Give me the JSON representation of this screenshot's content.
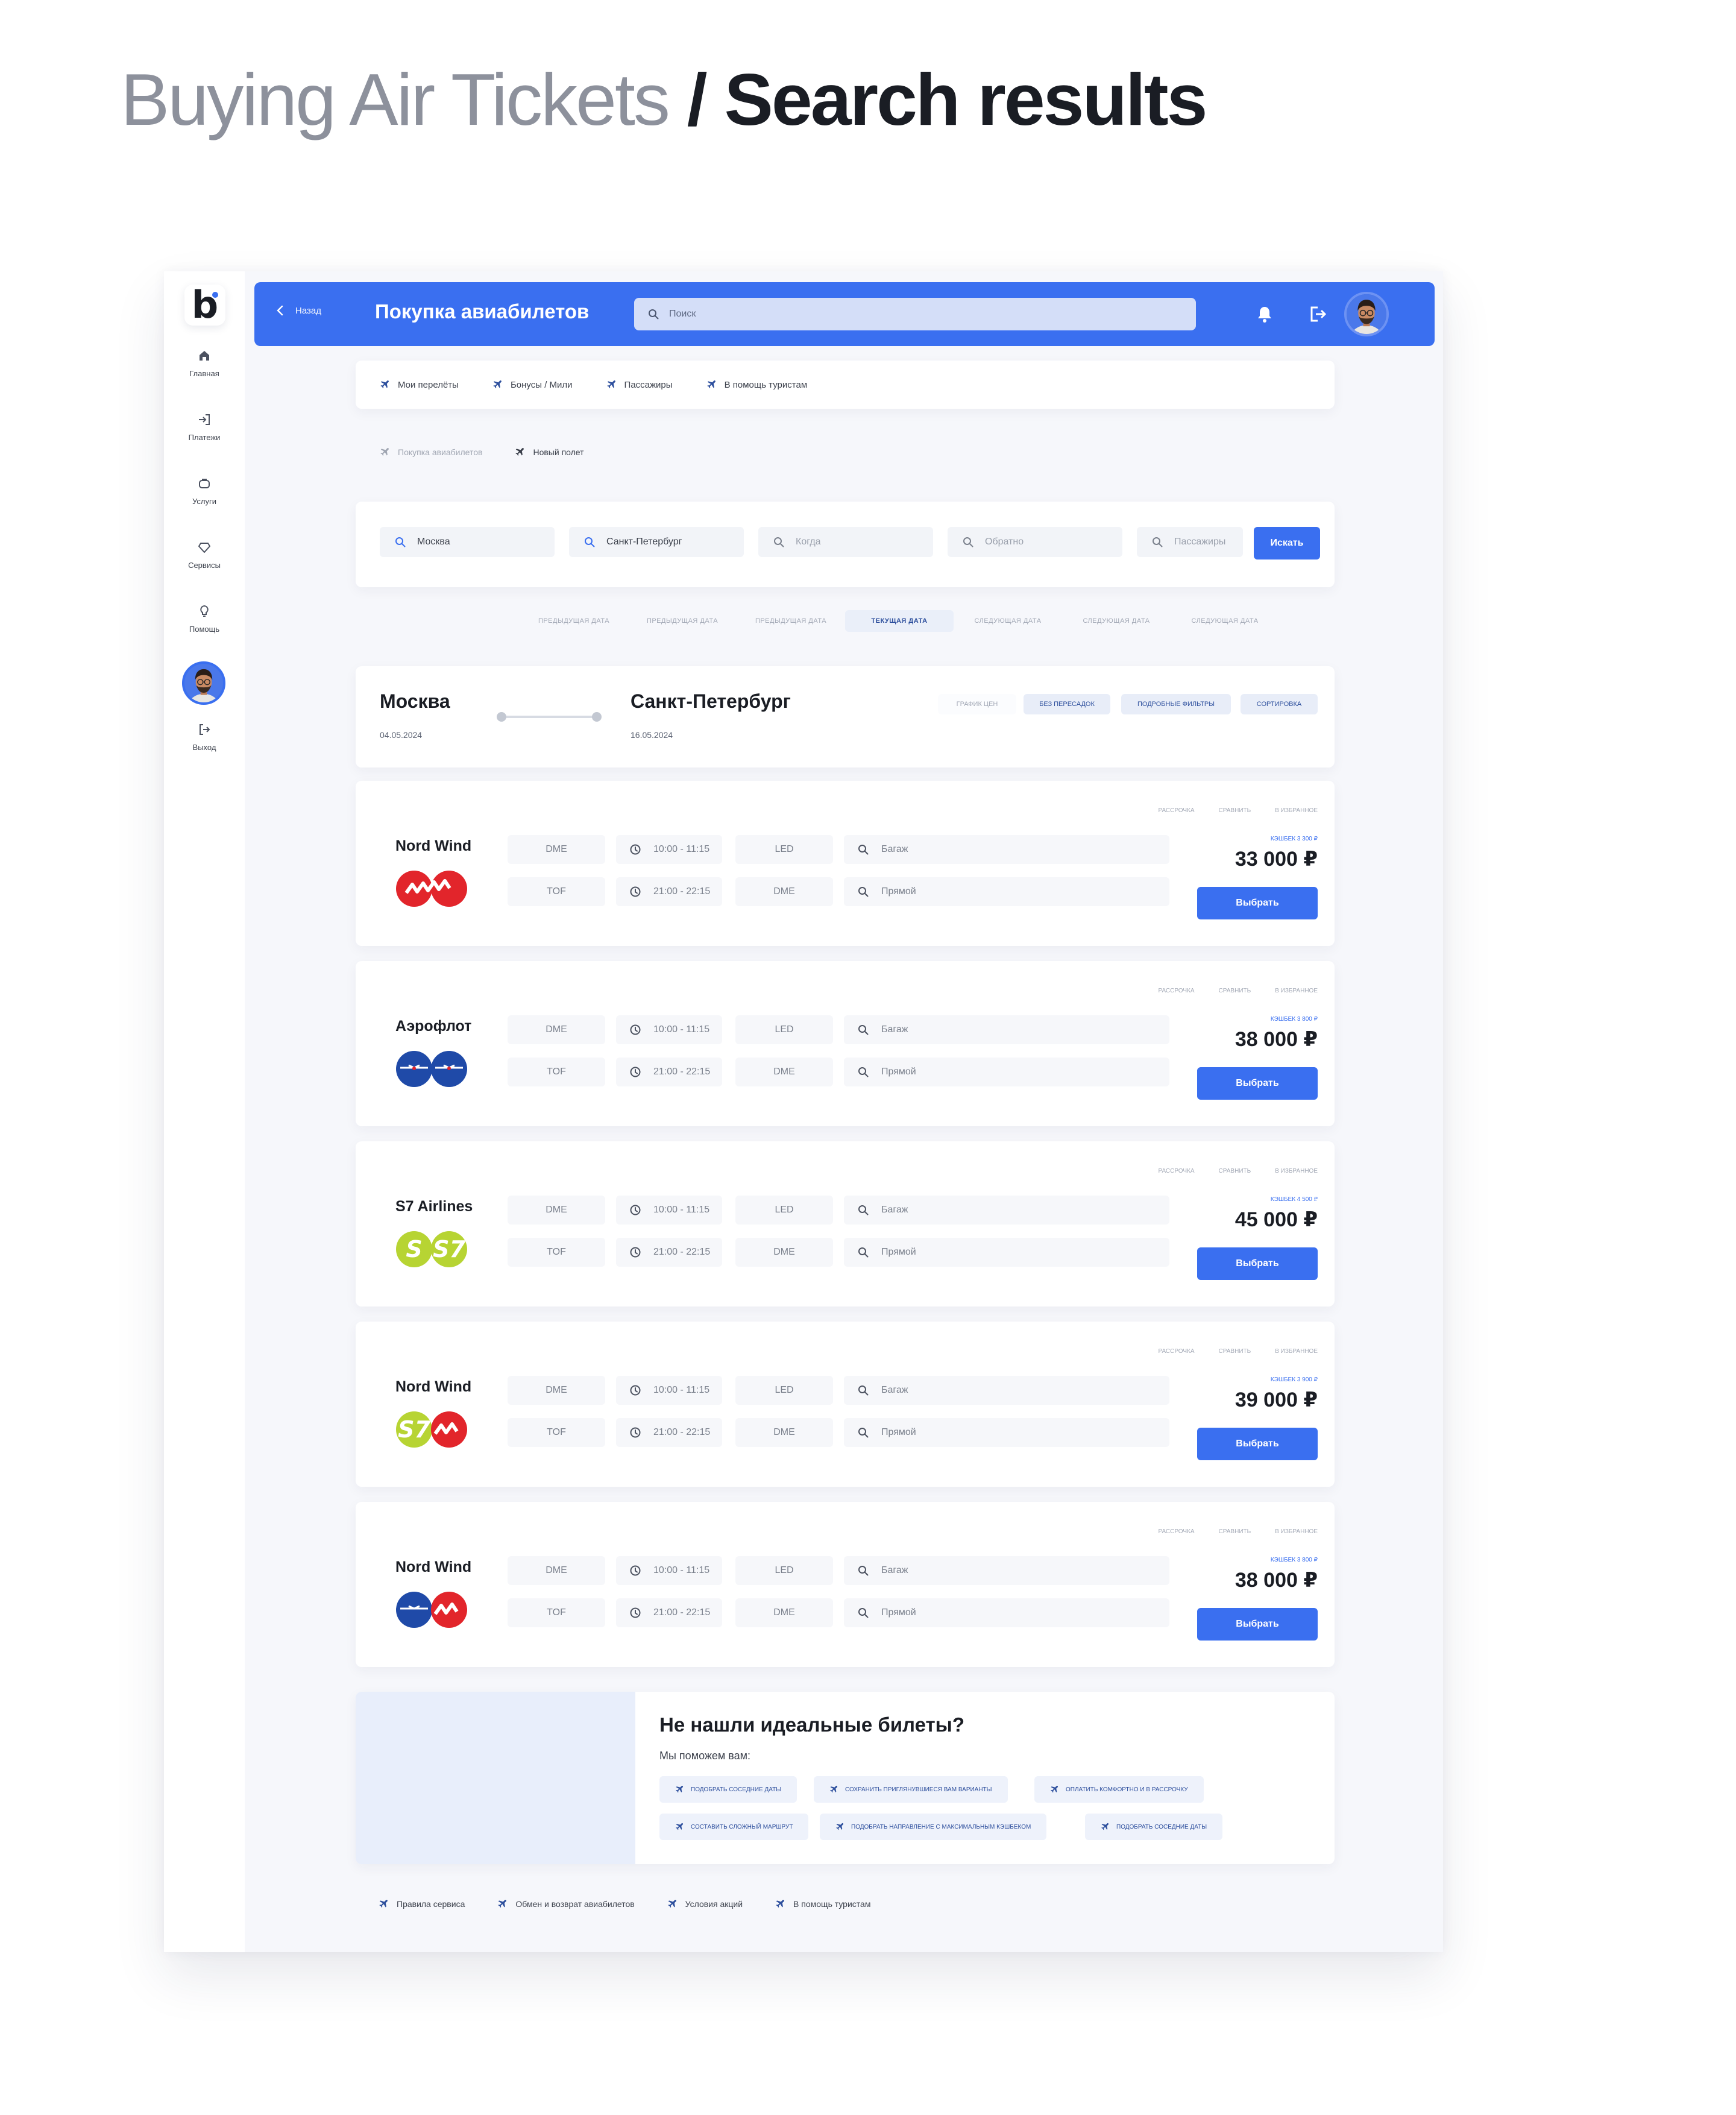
{
  "heading": {
    "light": "Buying Air Tickets",
    "sep": " / ",
    "bold": "Search results"
  },
  "sidebar": {
    "logo": "b",
    "items": [
      {
        "label": "Главная",
        "icon": "home-icon"
      },
      {
        "label": "Платежи",
        "icon": "payments-icon"
      },
      {
        "label": "Услуги",
        "icon": "services-icon"
      },
      {
        "label": "Сервисы",
        "icon": "diamond-icon"
      },
      {
        "label": "Помощь",
        "icon": "lightbulb-icon"
      }
    ],
    "logout": "Выход"
  },
  "header": {
    "back": "Назад",
    "title": "Покупка авиабилетов",
    "search_placeholder": "Поиск"
  },
  "tabs": [
    "Мои перелёты",
    "Бонусы / Мили",
    "Пассажиры",
    "В помощь туристам"
  ],
  "breadcrumbs": [
    "Покупка авиабилетов",
    "Новый полет"
  ],
  "search": {
    "from": "Москва",
    "to": "Санкт-Петербург",
    "when": "Когда",
    "back": "Обратно",
    "passengers": "Пассажиры",
    "button": "Искать"
  },
  "date_tabs": [
    "Предыдущая дата",
    "Предыдущая дата",
    "Предыдущая дата",
    "Текущая дата",
    "Следующая дата",
    "Следующая дата",
    "Следующая дата"
  ],
  "route": {
    "from": "Москва",
    "from_date": "04.05.2024",
    "to": "Санкт-Петербург",
    "to_date": "16.05.2024",
    "filters": [
      "График цен",
      "Без пересадок",
      "Подробные фильтры",
      "Сортировка"
    ]
  },
  "flight_labels": {
    "installment": "Рассрочка",
    "compare": "Сравнить",
    "favorites": "В избранное",
    "select": "Выбрать"
  },
  "flights": [
    {
      "airline": "Nord Wind",
      "dep1": "DME",
      "time1": "10:00 - 11:15",
      "arr1": "LED",
      "opt1": "Багаж",
      "dep2": "TOF",
      "time2": "21:00 - 22:15",
      "arr2": "DME",
      "opt2": "Прямой",
      "cashback": "Кэшбек 3 300 ₽",
      "price": "33 000 ₽"
    },
    {
      "airline": "Аэрофлот",
      "dep1": "DME",
      "time1": "10:00 - 11:15",
      "arr1": "LED",
      "opt1": "Багаж",
      "dep2": "TOF",
      "time2": "21:00 - 22:15",
      "arr2": "DME",
      "opt2": "Прямой",
      "cashback": "Кэшбек 3 800 ₽",
      "price": "38 000 ₽"
    },
    {
      "airline": "S7 Airlines",
      "dep1": "DME",
      "time1": "10:00 - 11:15",
      "arr1": "LED",
      "opt1": "Багаж",
      "dep2": "TOF",
      "time2": "21:00 - 22:15",
      "arr2": "DME",
      "opt2": "Прямой",
      "cashback": "Кэшбек 4 500 ₽",
      "price": "45 000 ₽"
    },
    {
      "airline": "Nord Wind",
      "dep1": "DME",
      "time1": "10:00 - 11:15",
      "arr1": "LED",
      "opt1": "Багаж",
      "dep2": "TOF",
      "time2": "21:00 - 22:15",
      "arr2": "DME",
      "opt2": "Прямой",
      "cashback": "Кэшбек 3 900 ₽",
      "price": "39 000 ₽"
    },
    {
      "airline": "Nord Wind",
      "dep1": "DME",
      "time1": "10:00 - 11:15",
      "arr1": "LED",
      "opt1": "Багаж",
      "dep2": "TOF",
      "time2": "21:00 - 22:15",
      "arr2": "DME",
      "opt2": "Прямой",
      "cashback": "Кэшбек 3 800 ₽",
      "price": "38 000 ₽"
    }
  ],
  "help": {
    "title": "Не нашли идеальные билеты?",
    "subtitle": "Мы поможем вам:",
    "chips": [
      "Подобрать соседние даты",
      "Сохранить приглянувшиеся вам варианты",
      "Оплатить комфортно и в рассрочку",
      "Составить сложный маршрут",
      "Подобрать направление с максимальным кэшбеком",
      "Подобрать соседние даты"
    ]
  },
  "footer": [
    "Правила сервиса",
    "Обмен и возврат авиабилетов",
    "Условия акций",
    "В помощь туристам"
  ],
  "colors": {
    "accent": "#3a6ff0",
    "nordwind": "#e2252b",
    "aeroflot": "#1f4aa8",
    "s7": "#b7d433"
  }
}
